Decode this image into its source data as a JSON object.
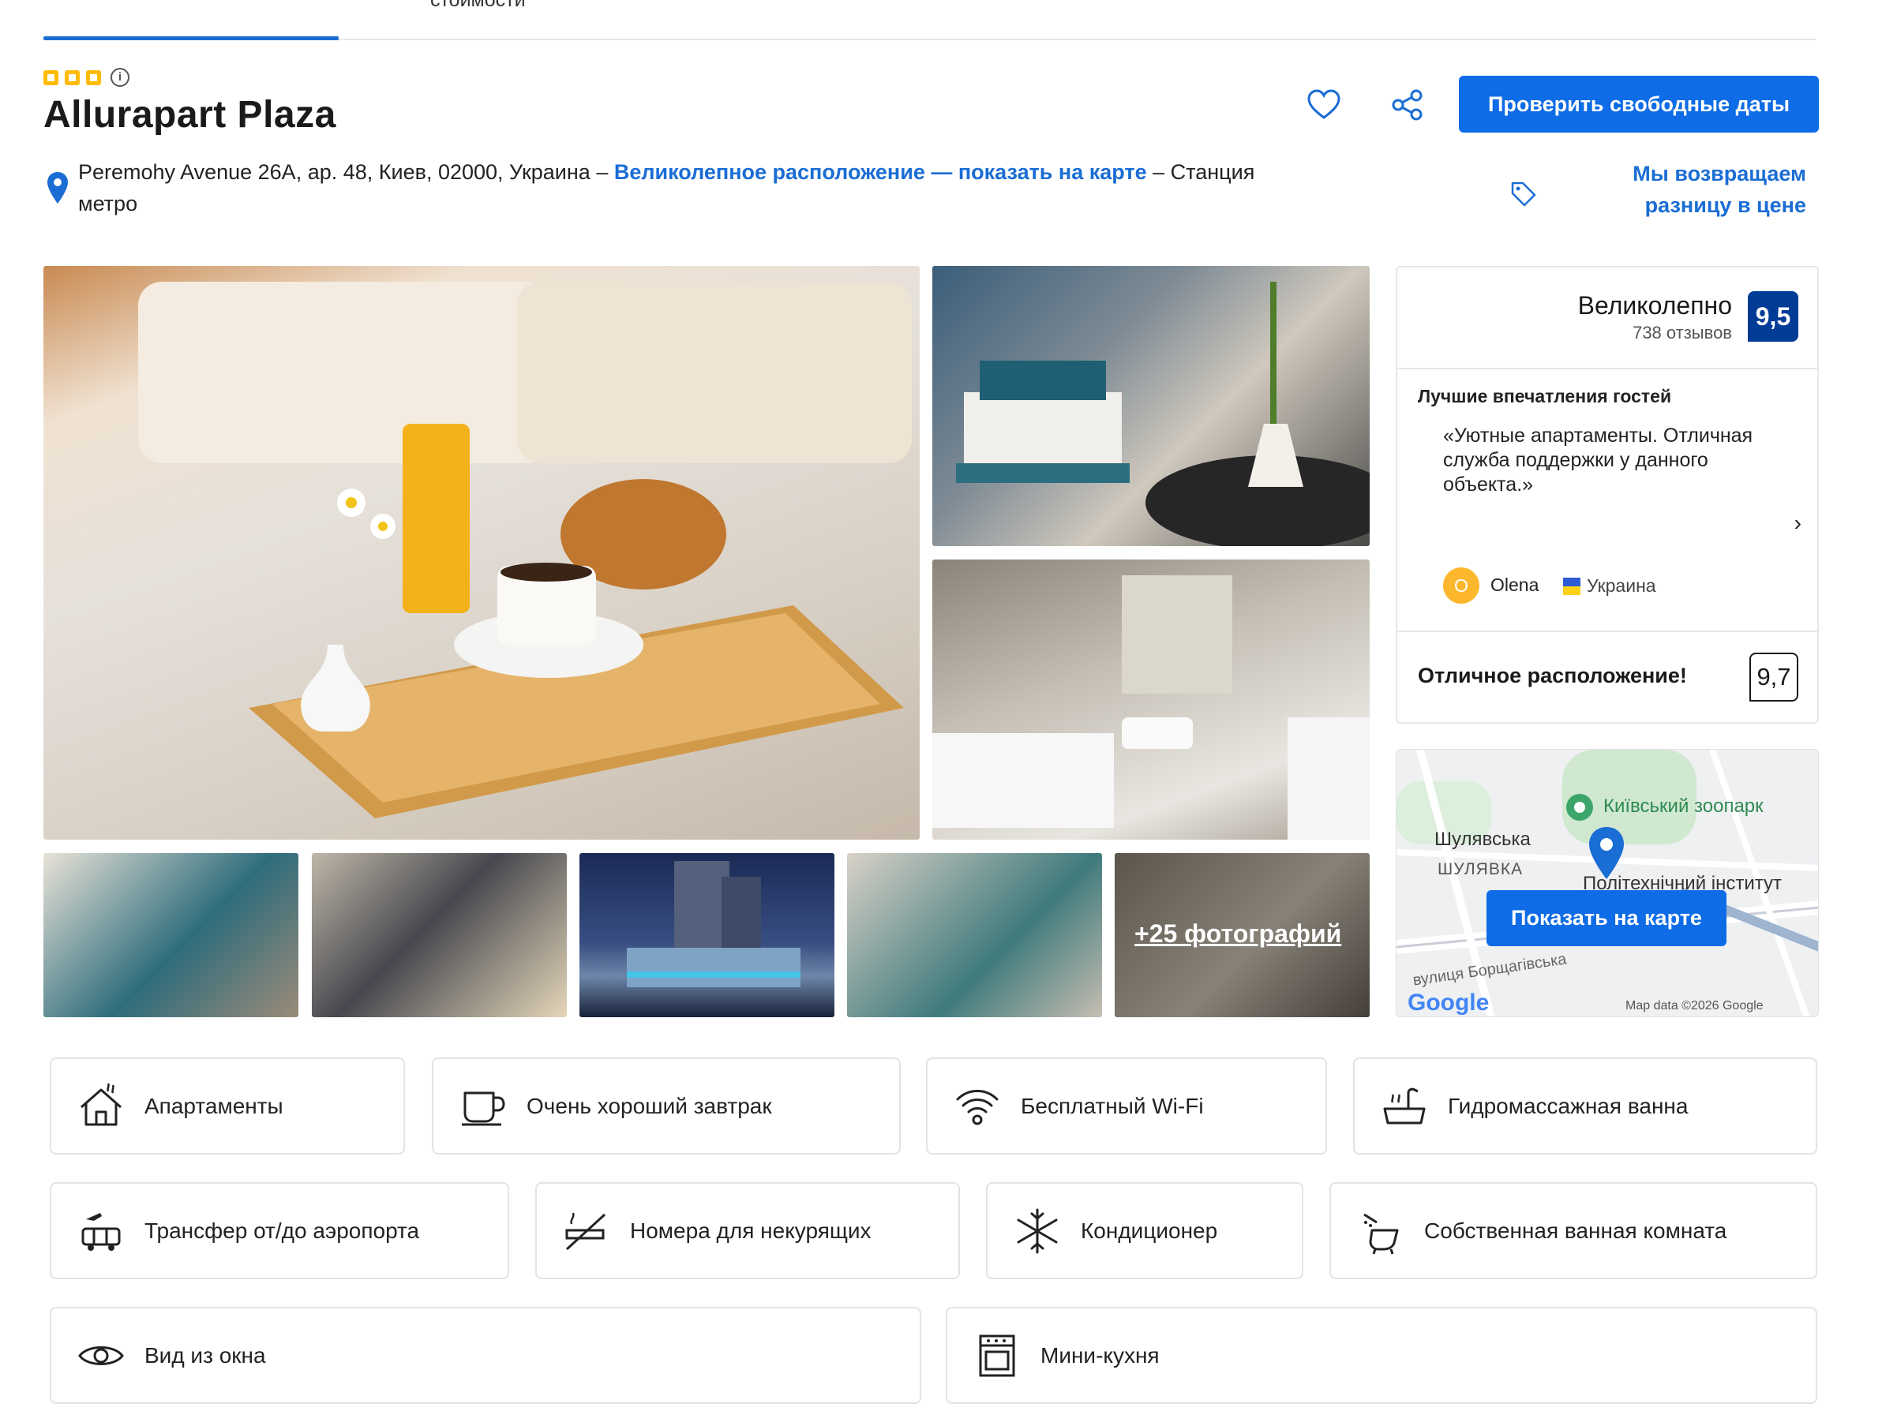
{
  "tabs": {
    "cut_label": "стоимости"
  },
  "hotel": {
    "title": "Allurapart Plaza",
    "address": "Peremohy Avenue 26A, ар. 48, Киев, 02000, Украина – ",
    "location_link": "Великолепное расположение — показать на карте",
    "address_tail": " – Станция метро"
  },
  "header_actions": {
    "cta_label": "Проверить свободные даты",
    "price_match_line1": "Мы возвращаем",
    "price_match_line2": "разницу в цене"
  },
  "gallery": {
    "more_photos": "+25 фотографий"
  },
  "review": {
    "label": "Великолепно",
    "count": "738 отзывов",
    "score": "9,5",
    "highlights_title": "Лучшие впечатления гостей",
    "quote": "«Уютные апартаменты. Отличная служба поддержки у данного объекта.»",
    "reviewer_initial": "O",
    "reviewer_name": "Olena",
    "reviewer_country": "Украина",
    "location_label": "Отличное расположение!",
    "location_score": "9,7"
  },
  "map": {
    "button": "Показать на карте",
    "poi_zoo": "Київський зоопарк",
    "poi_metro": "Шулявська",
    "district": "ШУЛЯВКА",
    "poi_institute": "Політехнічний інститут",
    "street": "вулиця Борщагівська",
    "logo": "Google",
    "copyright": "Map data ©2026 Google"
  },
  "facilities": [
    {
      "label": "Апартаменты",
      "icon": "house-icon"
    },
    {
      "label": "Очень хороший завтрак",
      "icon": "coffee-cup-icon"
    },
    {
      "label": "Бесплатный Wi-Fi",
      "icon": "wifi-icon"
    },
    {
      "label": "Гидромассажная ванна",
      "icon": "hot-tub-icon"
    },
    {
      "label": "Трансфер от/до аэропорта",
      "icon": "airport-shuttle-icon"
    },
    {
      "label": "Номера для некурящих",
      "icon": "no-smoking-icon"
    },
    {
      "label": "Кондиционер",
      "icon": "snowflake-icon"
    },
    {
      "label": "Собственная ванная комната",
      "icon": "bath-icon"
    },
    {
      "label": "Вид из окна",
      "icon": "eye-icon"
    },
    {
      "label": "Мини-кухня",
      "icon": "stove-icon"
    }
  ],
  "colors": {
    "accent": "#0d6ce6",
    "score_bg": "#003b95",
    "link": "#1a6dd4",
    "star": "#febb02"
  }
}
